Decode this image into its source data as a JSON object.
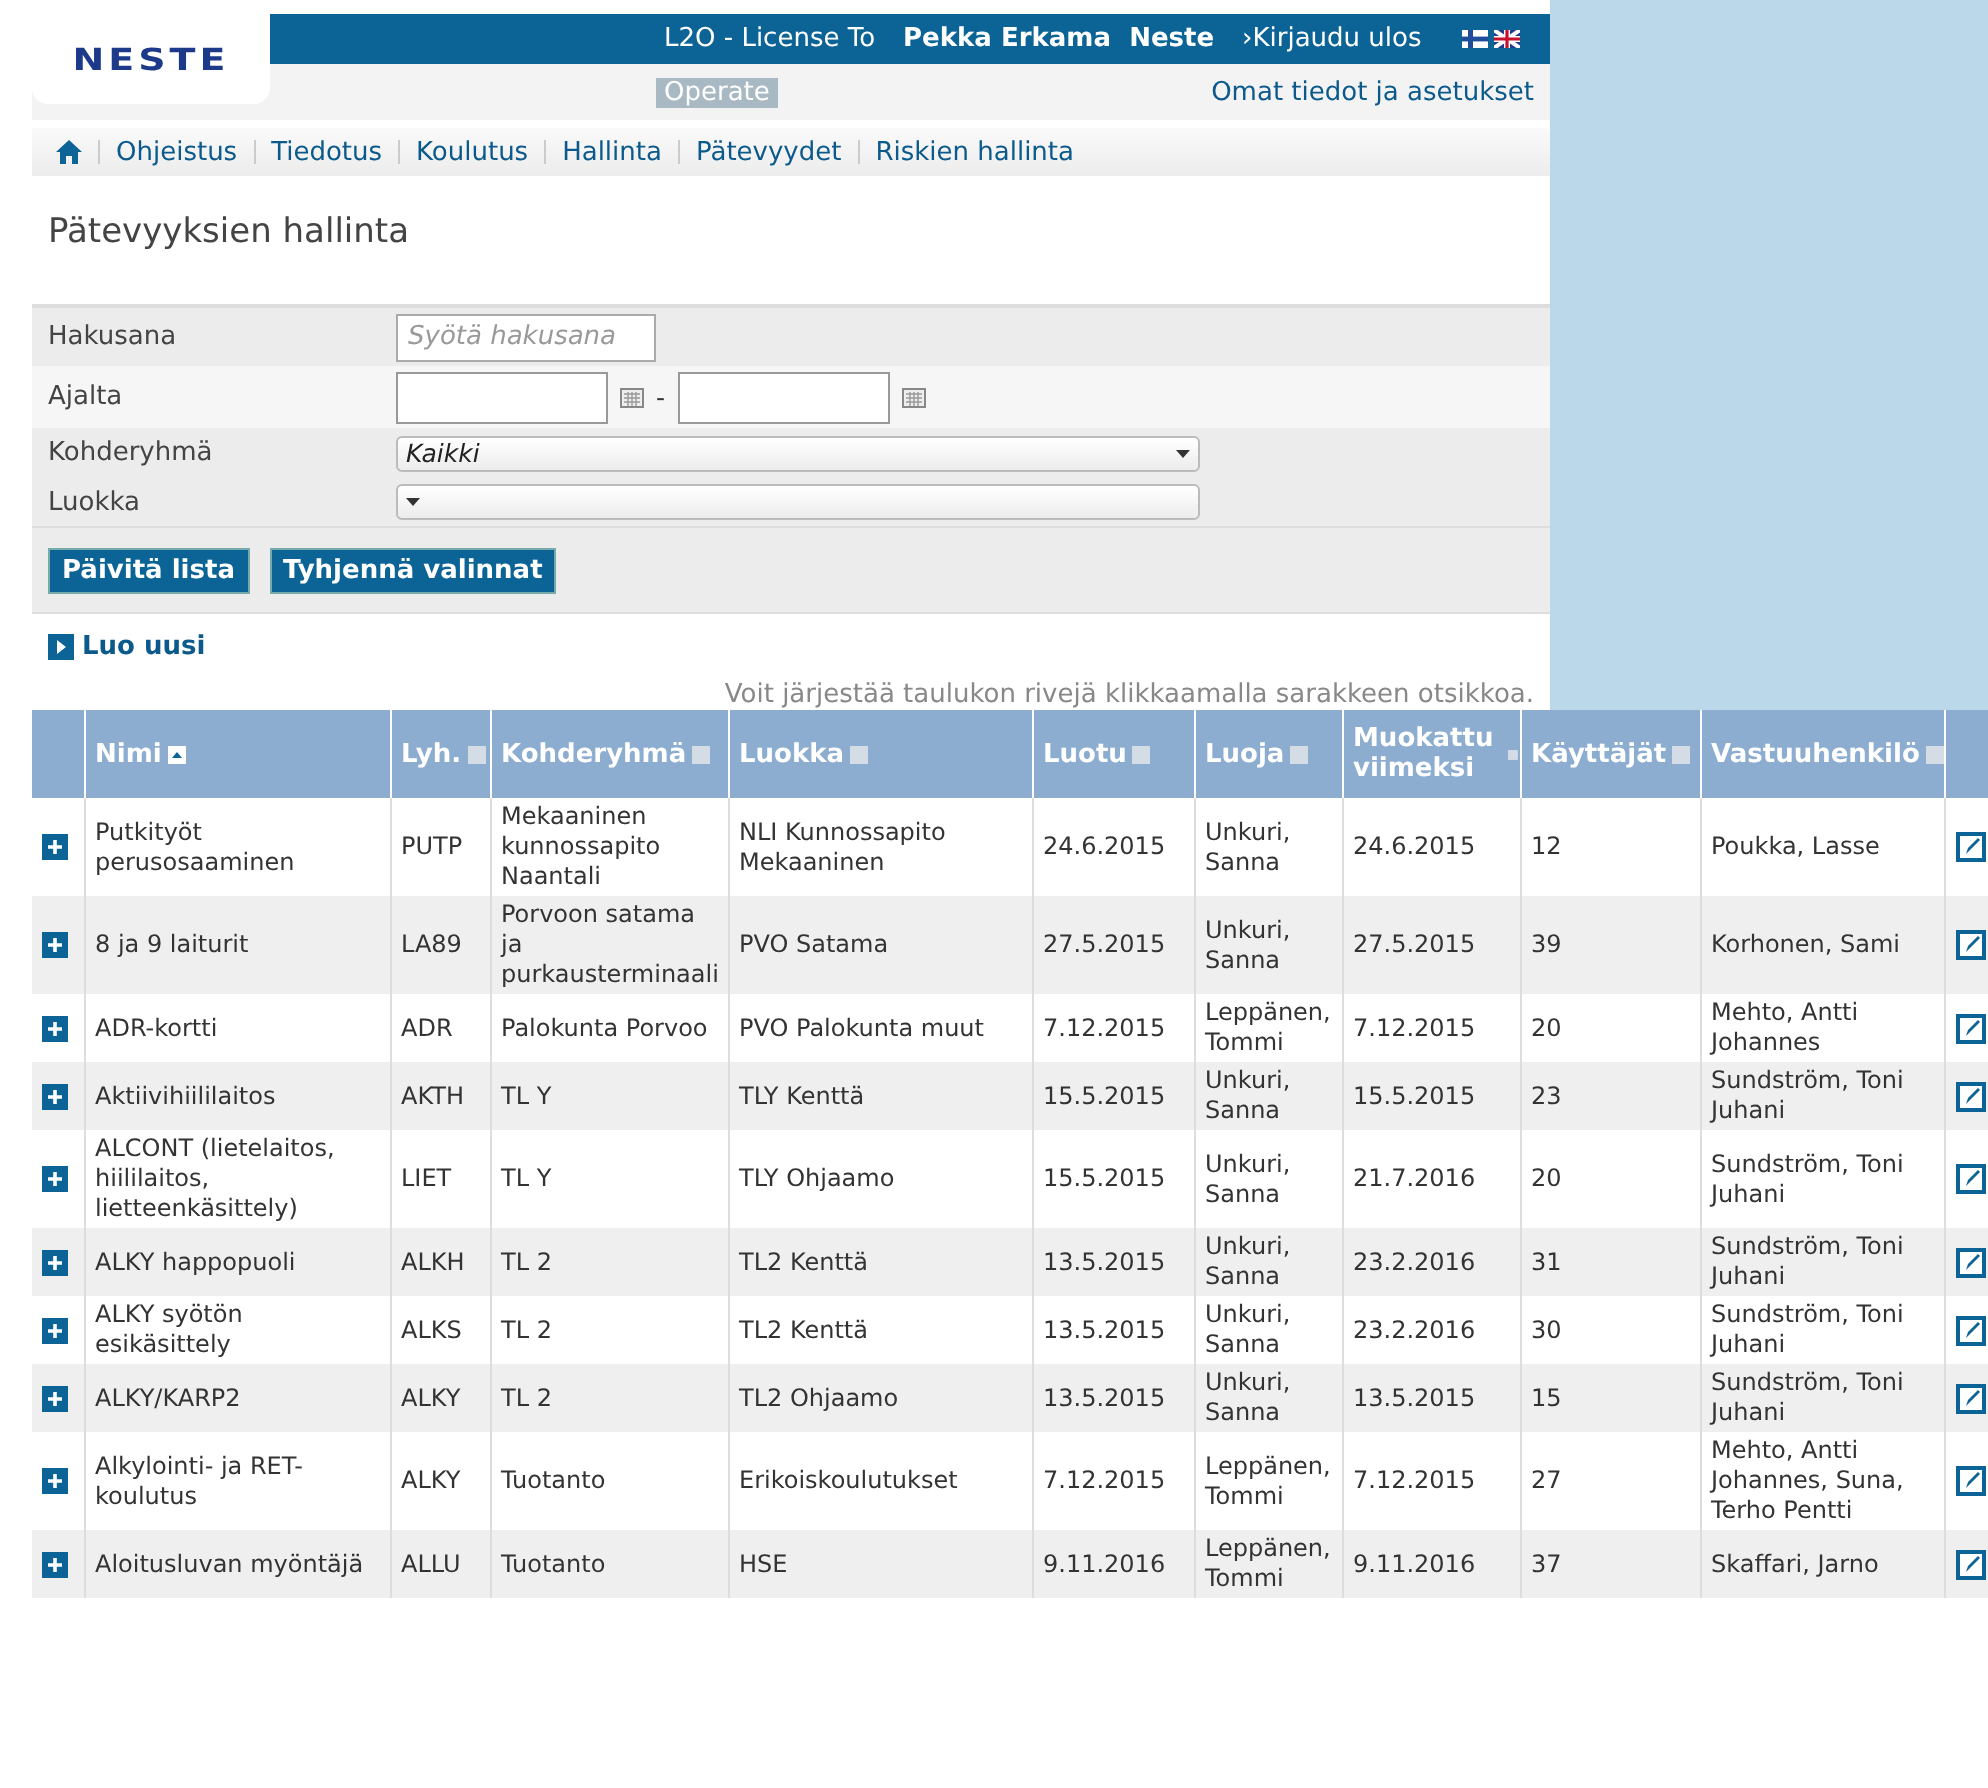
{
  "header": {
    "logo": "NESTE",
    "app_title": "L2O - License To",
    "app_subtitle": "Operate",
    "user": "Pekka Erkama",
    "company": "Neste",
    "logout": "›Kirjaudu ulos",
    "settings_link": "Omat tiedot ja asetukset"
  },
  "nav": [
    "Ohjeistus",
    "Tiedotus",
    "Koulutus",
    "Hallinta",
    "Pätevyydet",
    "Riskien hallinta"
  ],
  "page_title": "Pätevyyksien hallinta",
  "filters": [
    {
      "kind": "text",
      "label": "Hakusana",
      "placeholder": "Syötä hakusana"
    },
    {
      "kind": "daterange",
      "label": "Ajalta",
      "separator": "-"
    },
    {
      "kind": "select",
      "label": "Kohderyhmä",
      "value": "Kaikki"
    },
    {
      "kind": "select",
      "label": "Luokka"
    }
  ],
  "buttons": [
    "Päivitä lista",
    "Tyhjennä valinnat"
  ],
  "create_link": "Luo uusi",
  "hint": "Voit järjestää taulukon rivejä klikkaamalla sarakkeen otsikkoa.",
  "table": {
    "columns": [
      {
        "label": "Nimi",
        "sorted": true
      },
      {
        "label": "Lyh.",
        "sorted": false
      },
      {
        "label": "Kohderyhmä",
        "sorted": false
      },
      {
        "label": "Luokka",
        "sorted": false
      },
      {
        "label": "Luotu",
        "sorted": false
      },
      {
        "label": "Luoja",
        "sorted": false
      },
      {
        "label": "Muokattu viimeksi",
        "sorted": false
      },
      {
        "label": "Käyttäjät",
        "sorted": false
      },
      {
        "label": "Vastuuhenkilö",
        "sorted": false
      }
    ],
    "rows": [
      [
        "Putkityöt perusosaaminen",
        "PUTP",
        "Mekaaninen kunnossapito Naantali",
        "NLI Kunnossapito Mekaaninen",
        "24.6.2015",
        "Unkuri, Sanna",
        "24.6.2015",
        "12",
        "Poukka, Lasse"
      ],
      [
        "8 ja 9 laiturit",
        "LA89",
        "Porvoon satama ja purkausterminaali",
        "PVO Satama",
        "27.5.2015",
        "Unkuri, Sanna",
        "27.5.2015",
        "39",
        "Korhonen, Sami"
      ],
      [
        "ADR-kortti",
        "ADR",
        "Palokunta Porvoo",
        "PVO Palokunta muut",
        "7.12.2015",
        "Leppänen, Tommi",
        "7.12.2015",
        "20",
        "Mehto, Antti Johannes"
      ],
      [
        "Aktiivihiililaitos",
        "AKTH",
        "TL Y",
        "TLY Kenttä",
        "15.5.2015",
        "Unkuri, Sanna",
        "15.5.2015",
        "23",
        "Sundström, Toni Juhani"
      ],
      [
        "ALCONT (lietelaitos, hiililaitos, lietteenkäsittely)",
        "LIET",
        "TL Y",
        "TLY Ohjaamo",
        "15.5.2015",
        "Unkuri, Sanna",
        "21.7.2016",
        "20",
        "Sundström, Toni Juhani"
      ],
      [
        "ALKY happopuoli",
        "ALKH",
        "TL 2",
        "TL2 Kenttä",
        "13.5.2015",
        "Unkuri, Sanna",
        "23.2.2016",
        "31",
        "Sundström, Toni Juhani"
      ],
      [
        "ALKY syötön esikäsittely",
        "ALKS",
        "TL 2",
        "TL2 Kenttä",
        "13.5.2015",
        "Unkuri, Sanna",
        "23.2.2016",
        "30",
        "Sundström, Toni Juhani"
      ],
      [
        "ALKY/KARP2",
        "ALKY",
        "TL 2",
        "TL2 Ohjaamo",
        "13.5.2015",
        "Unkuri, Sanna",
        "13.5.2015",
        "15",
        "Sundström, Toni Juhani"
      ],
      [
        "Alkylointi- ja RET-koulutus",
        "ALKY",
        "Tuotanto",
        "Erikoiskoulutukset",
        "7.12.2015",
        "Leppänen, Tommi",
        "7.12.2015",
        "27",
        "Mehto, Antti Johannes, Suna, Terho Pentti"
      ],
      [
        "Aloitusluvan myöntäjä",
        "ALLU",
        "Tuotanto",
        "HSE",
        "9.11.2016",
        "Leppänen, Tommi",
        "9.11.2016",
        "37",
        "Skaffari, Jarno"
      ]
    ]
  }
}
